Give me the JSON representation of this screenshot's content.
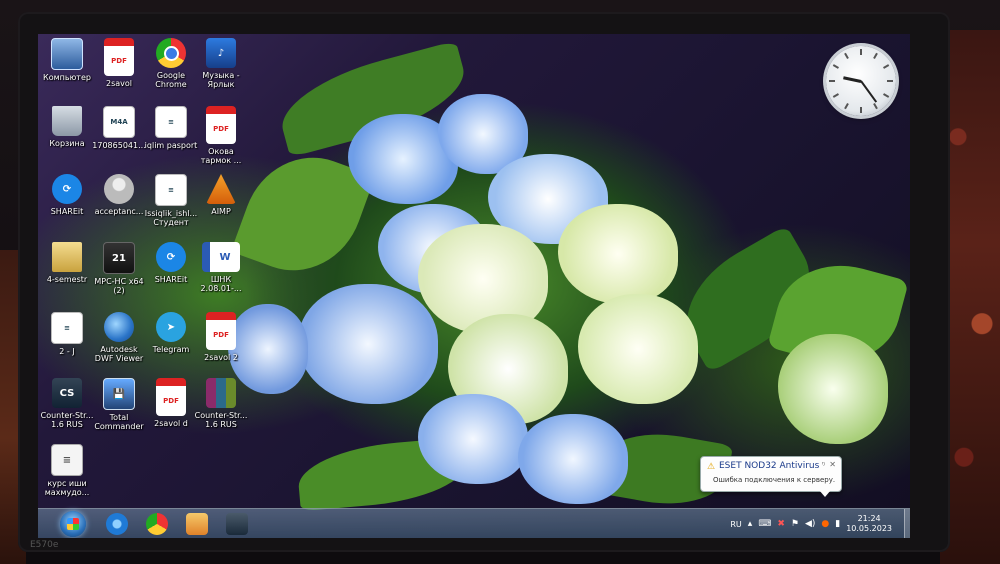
{
  "desktop": {
    "icons": [
      {
        "label": "Компьютер",
        "icon": "computer-icon",
        "glyph": ""
      },
      {
        "label": "2savol",
        "icon": "pdf-icon",
        "glyph": "PDF"
      },
      {
        "label": "Google\nChrome",
        "icon": "chrome-icon",
        "glyph": ""
      },
      {
        "label": "Музыка -\nЯрлык",
        "icon": "music-icon",
        "glyph": "♪"
      },
      {
        "label": "Корзина",
        "icon": "recycle-bin-icon",
        "glyph": ""
      },
      {
        "label": "170865041...",
        "icon": "m4a-file-icon",
        "glyph": "M4A"
      },
      {
        "label": "iqlim pasport",
        "icon": "document-icon",
        "glyph": "≡"
      },
      {
        "label": "Окова\nтармок ...",
        "icon": "pdf-icon",
        "glyph": "PDF"
      },
      {
        "label": "SHAREit",
        "icon": "shareit-icon",
        "glyph": "⟳"
      },
      {
        "label": "acceptanc...",
        "icon": "user-icon",
        "glyph": ""
      },
      {
        "label": "Issiqlik_ishl...\nСтудент",
        "icon": "document-icon",
        "glyph": "≡"
      },
      {
        "label": "AIMP",
        "icon": "aimp-icon",
        "glyph": ""
      },
      {
        "label": "4-semestr",
        "icon": "folder-icon",
        "glyph": ""
      },
      {
        "label": "MPC-HC x64\n(2)",
        "icon": "mpc-icon",
        "glyph": "21"
      },
      {
        "label": "SHAREit",
        "icon": "shareit-icon",
        "glyph": "⟳"
      },
      {
        "label": "ШНК\n2.08.01-...",
        "icon": "word-icon",
        "glyph": "W"
      },
      {
        "label": "2 - J",
        "icon": "document-icon",
        "glyph": "≡"
      },
      {
        "label": "Autodesk\nDWF Viewer",
        "icon": "globe-icon",
        "glyph": ""
      },
      {
        "label": "Telegram",
        "icon": "telegram-icon",
        "glyph": "➤"
      },
      {
        "label": "2savol 2",
        "icon": "pdf-icon",
        "glyph": "PDF"
      },
      {
        "label": "Counter-Str...\n1.6 RUS",
        "icon": "counter-strike-icon",
        "glyph": "CS"
      },
      {
        "label": "Total\nCommander",
        "icon": "total-commander-icon",
        "glyph": "💾"
      },
      {
        "label": "2savol d",
        "icon": "pdf-icon",
        "glyph": "PDF"
      },
      {
        "label": "Counter-Str...\n1.6 RUS",
        "icon": "winrar-icon",
        "glyph": ""
      },
      {
        "label": "курс иши\nмахмудо...",
        "icon": "text-file-icon",
        "glyph": "≡"
      }
    ]
  },
  "gadget": {
    "clock": {
      "hour": 9,
      "minute": 24
    }
  },
  "notification": {
    "title": "ESET NOD32 Antivirus",
    "message": "Ошибка подключения к серверу.",
    "warning_symbol": "⚠",
    "close_symbol": "✕",
    "options_symbol": "ᵑ"
  },
  "taskbar": {
    "pinned": [
      {
        "name": "internet-explorer-icon"
      },
      {
        "name": "chrome-icon"
      },
      {
        "name": "media-player-icon"
      },
      {
        "name": "counter-strike-icon"
      }
    ],
    "tray": {
      "language": "RU",
      "time": "21:24",
      "date": "10.05.2023"
    }
  },
  "bezel": {
    "model": "E570e"
  }
}
